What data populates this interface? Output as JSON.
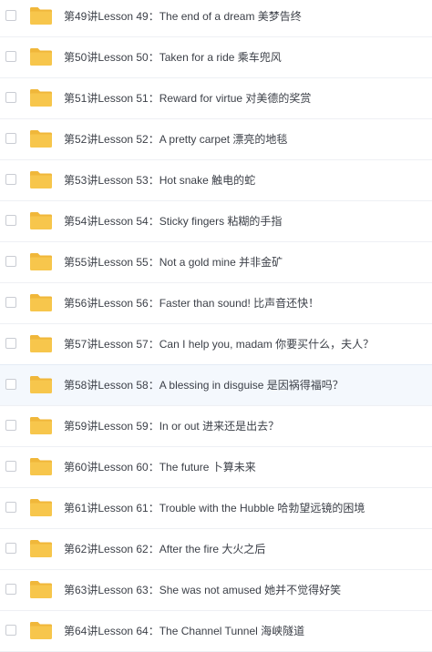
{
  "folder_color": "#f7c64c",
  "folder_tab_color": "#f0b73a",
  "items": [
    {
      "name": "第49讲Lesson 49：The end of a dream 美梦告终"
    },
    {
      "name": "第50讲Lesson 50：Taken for a ride 乘车兜风"
    },
    {
      "name": "第51讲Lesson 51：Reward for virtue 对美德的奖赏"
    },
    {
      "name": "第52讲Lesson 52：A pretty carpet 漂亮的地毯"
    },
    {
      "name": "第53讲Lesson 53：Hot snake 触电的蛇"
    },
    {
      "name": "第54讲Lesson 54：Sticky fingers 粘糊的手指"
    },
    {
      "name": "第55讲Lesson 55：Not a gold mine 并非金矿"
    },
    {
      "name": "第56讲Lesson 56：Faster than sound! 比声音还快！"
    },
    {
      "name": "第57讲Lesson 57：Can I help you, madam 你要买什么，夫人？"
    },
    {
      "name": "第58讲Lesson 58：A blessing in disguise 是因祸得福吗？",
      "hover": true
    },
    {
      "name": "第59讲Lesson 59：In or out 进来还是出去？"
    },
    {
      "name": "第60讲Lesson 60：The future 卜算未来"
    },
    {
      "name": "第61讲Lesson 61：Trouble with the Hubble 哈勃望远镜的困境"
    },
    {
      "name": "第62讲Lesson 62：After the fire 大火之后"
    },
    {
      "name": "第63讲Lesson 63：She was not amused 她并不觉得好笑"
    },
    {
      "name": "第64讲Lesson 64：The Channel Tunnel 海峡隧道"
    }
  ]
}
